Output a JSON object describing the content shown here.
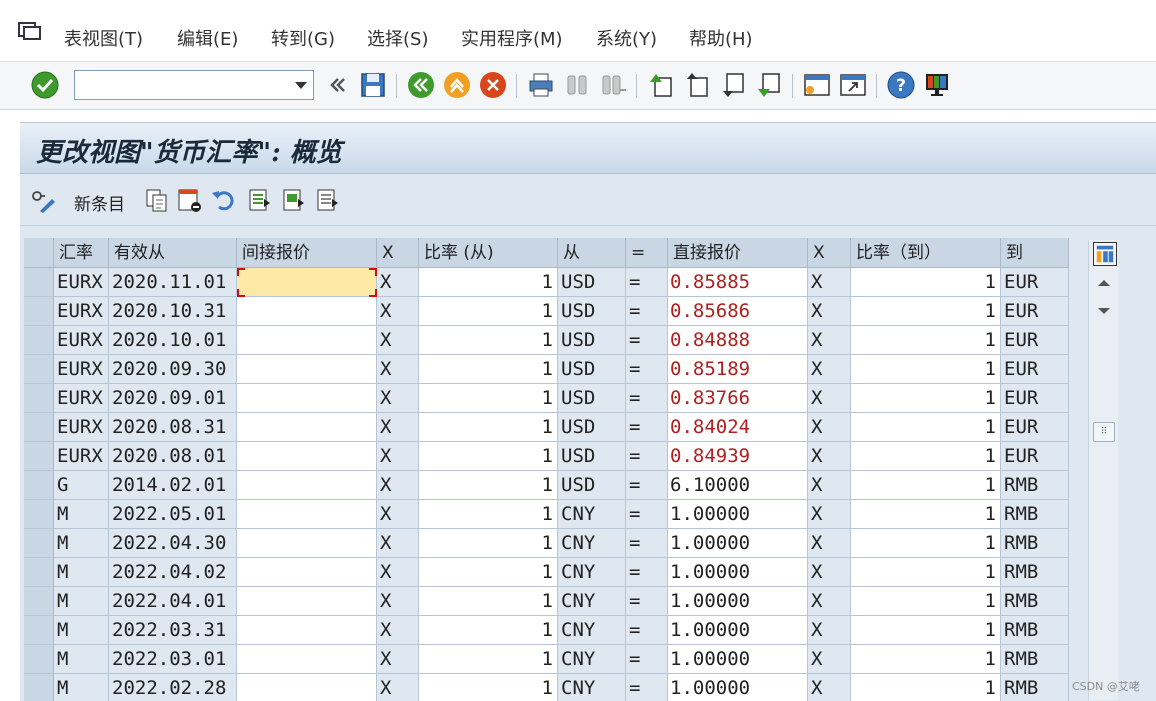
{
  "menubar": {
    "icon": "menu-window-icon",
    "items": [
      "表视图(T)",
      "编辑(E)",
      "转到(G)",
      "选择(S)",
      "实用程序(M)",
      "系统(Y)",
      "帮助(H)"
    ]
  },
  "toolbar": {
    "command_field_value": "",
    "icons": [
      "enter-check-icon",
      "command-dropdown-icon",
      "collapse-chevron-icon",
      "save-icon",
      "back-icon",
      "exit-icon",
      "cancel-icon",
      "print-icon",
      "find-icon",
      "find-next-icon",
      "first-page-icon",
      "previous-page-icon",
      "next-page-icon",
      "last-page-icon",
      "new-session-icon",
      "shortcut-icon",
      "help-icon",
      "layout-settings-icon"
    ]
  },
  "title": "更改视图\"货币汇率\": 概览",
  "app_toolbar": {
    "new_entries_label": "新条目",
    "icons": [
      "edit-toggle-icon",
      "copy-as-icon",
      "delete-icon",
      "undo-change-icon",
      "select-all-icon",
      "select-block-icon",
      "deselect-all-icon"
    ]
  },
  "table": {
    "headers": [
      "汇率",
      "有效从",
      "间接报价",
      "X",
      "比率 (从)",
      "从",
      "=",
      "直接报价",
      "X",
      "比率（到）",
      "到"
    ],
    "rows": [
      {
        "type": "EURX",
        "date": "2020.11.01",
        "indirect": "",
        "x1": "X",
        "ratio_from": "1",
        "from": "USD",
        "eq": "=",
        "direct": "0.85885",
        "x2": "X",
        "ratio_to": "1",
        "to": "EUR",
        "highlight": true
      },
      {
        "type": "EURX",
        "date": "2020.10.31",
        "indirect": "",
        "x1": "X",
        "ratio_from": "1",
        "from": "USD",
        "eq": "=",
        "direct": "0.85686",
        "x2": "X",
        "ratio_to": "1",
        "to": "EUR",
        "highlight": true
      },
      {
        "type": "EURX",
        "date": "2020.10.01",
        "indirect": "",
        "x1": "X",
        "ratio_from": "1",
        "from": "USD",
        "eq": "=",
        "direct": "0.84888",
        "x2": "X",
        "ratio_to": "1",
        "to": "EUR",
        "highlight": true
      },
      {
        "type": "EURX",
        "date": "2020.09.30",
        "indirect": "",
        "x1": "X",
        "ratio_from": "1",
        "from": "USD",
        "eq": "=",
        "direct": "0.85189",
        "x2": "X",
        "ratio_to": "1",
        "to": "EUR",
        "highlight": true
      },
      {
        "type": "EURX",
        "date": "2020.09.01",
        "indirect": "",
        "x1": "X",
        "ratio_from": "1",
        "from": "USD",
        "eq": "=",
        "direct": "0.83766",
        "x2": "X",
        "ratio_to": "1",
        "to": "EUR",
        "highlight": true
      },
      {
        "type": "EURX",
        "date": "2020.08.31",
        "indirect": "",
        "x1": "X",
        "ratio_from": "1",
        "from": "USD",
        "eq": "=",
        "direct": "0.84024",
        "x2": "X",
        "ratio_to": "1",
        "to": "EUR",
        "highlight": true
      },
      {
        "type": "EURX",
        "date": "2020.08.01",
        "indirect": "",
        "x1": "X",
        "ratio_from": "1",
        "from": "USD",
        "eq": "=",
        "direct": "0.84939",
        "x2": "X",
        "ratio_to": "1",
        "to": "EUR",
        "highlight": true
      },
      {
        "type": "G",
        "date": "2014.02.01",
        "indirect": "",
        "x1": "X",
        "ratio_from": "1",
        "from": "USD",
        "eq": "=",
        "direct": "6.10000",
        "x2": "X",
        "ratio_to": "1",
        "to": "RMB",
        "highlight": false
      },
      {
        "type": "M",
        "date": "2022.05.01",
        "indirect": "",
        "x1": "X",
        "ratio_from": "1",
        "from": "CNY",
        "eq": "=",
        "direct": "1.00000",
        "x2": "X",
        "ratio_to": "1",
        "to": "RMB",
        "highlight": false
      },
      {
        "type": "M",
        "date": "2022.04.30",
        "indirect": "",
        "x1": "X",
        "ratio_from": "1",
        "from": "CNY",
        "eq": "=",
        "direct": "1.00000",
        "x2": "X",
        "ratio_to": "1",
        "to": "RMB",
        "highlight": false
      },
      {
        "type": "M",
        "date": "2022.04.02",
        "indirect": "",
        "x1": "X",
        "ratio_from": "1",
        "from": "CNY",
        "eq": "=",
        "direct": "1.00000",
        "x2": "X",
        "ratio_to": "1",
        "to": "RMB",
        "highlight": false
      },
      {
        "type": "M",
        "date": "2022.04.01",
        "indirect": "",
        "x1": "X",
        "ratio_from": "1",
        "from": "CNY",
        "eq": "=",
        "direct": "1.00000",
        "x2": "X",
        "ratio_to": "1",
        "to": "RMB",
        "highlight": false
      },
      {
        "type": "M",
        "date": "2022.03.31",
        "indirect": "",
        "x1": "X",
        "ratio_from": "1",
        "from": "CNY",
        "eq": "=",
        "direct": "1.00000",
        "x2": "X",
        "ratio_to": "1",
        "to": "RMB",
        "highlight": false
      },
      {
        "type": "M",
        "date": "2022.03.01",
        "indirect": "",
        "x1": "X",
        "ratio_from": "1",
        "from": "CNY",
        "eq": "=",
        "direct": "1.00000",
        "x2": "X",
        "ratio_to": "1",
        "to": "RMB",
        "highlight": false
      },
      {
        "type": "M",
        "date": "2022.02.28",
        "indirect": "",
        "x1": "X",
        "ratio_from": "1",
        "from": "CNY",
        "eq": "=",
        "direct": "1.00000",
        "x2": "X",
        "ratio_to": "1",
        "to": "RMB",
        "highlight": false
      }
    ]
  },
  "side_controls": {
    "icons": [
      "table-settings-icon",
      "scroll-up-icon",
      "scroll-down-icon",
      "scroll-thumb-icon"
    ]
  },
  "watermark": "CSDN @艾咾",
  "colors": {
    "highlight_value": "#b02020",
    "focused_cell": "#ffe9a6",
    "panel_bg": "#dfe8f1"
  }
}
